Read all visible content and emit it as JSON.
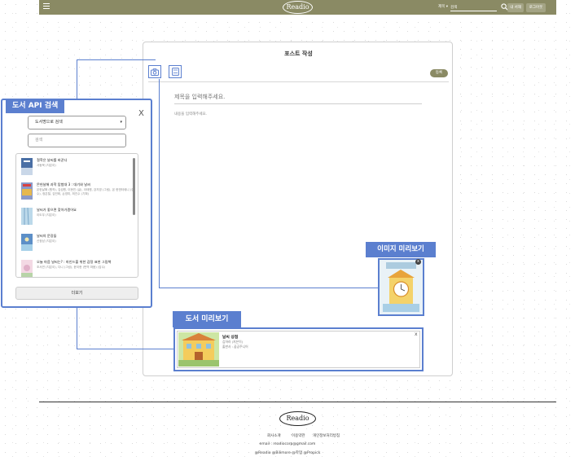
{
  "header": {
    "logo": "Readio",
    "search_select": "제목 ▾",
    "search_placeholder": "검색",
    "btn_signup": "내 서재",
    "btn_login": "로그아웃"
  },
  "post": {
    "title": "포스트 작성",
    "submit_label": "등록",
    "title_placeholder": "제목을 입력해주세요.",
    "content_placeholder": "내용을 입력해주세요."
  },
  "book_search": {
    "tag": "도서 API 검색",
    "close": "X",
    "select_value": "도서명으로 검색",
    "search_placeholder": "검색",
    "results": [
      {
        "title": "철학은 날씨를 바꾼다",
        "author": "서동욱 (지은이)",
        "cover": "#4a6fa5"
      },
      {
        "title": "몬헌날해 과학 탐험대 3 : 대기와 날씨",
        "author": "몬헌날해 (원작), 김성원, 이현진 (글), 이태원, 강지영 (그림), 몬 헌엔터테니 (감수), 정은철, 김민희, 손영미, 최진수 (기획)",
        "cover": "#8a9ac9"
      },
      {
        "title": "날씨가 좋으면 찾아가겠어요",
        "author": "이도우 (지은이)",
        "cover": "#9cc3dc"
      },
      {
        "title": "날씨의 문장들",
        "author": "신정남 (지은이)",
        "cover": "#5d8fc7"
      },
      {
        "title": "오늘 마음 날씨는? : 마인드풀 위한 감정 표현 그림책",
        "author": "조서연 (지은이), 다니 (그림), 윤이현 (번역 마음) (감수)",
        "cover": "#e0b0c8"
      }
    ],
    "more_label": "더보기"
  },
  "image_preview": {
    "tag": "이미지 미리보기",
    "close": "x"
  },
  "book_preview": {
    "tag": "도서 미리보기",
    "title": "날씨 상점",
    "author": "김하라 (지은이)",
    "publisher": "출판사 : 꿈공주니어",
    "close": "x"
  },
  "footer": {
    "logo": "Readio",
    "links": [
      "회사소개",
      "이용약관",
      "개인정보처리방침"
    ],
    "email": "email : readiocorp@gmail.com",
    "credit": "@Readio @Bilimore @학업 @Propick"
  },
  "colors": {
    "header": "#8a8a64",
    "annotation": "#5b7fcf"
  }
}
